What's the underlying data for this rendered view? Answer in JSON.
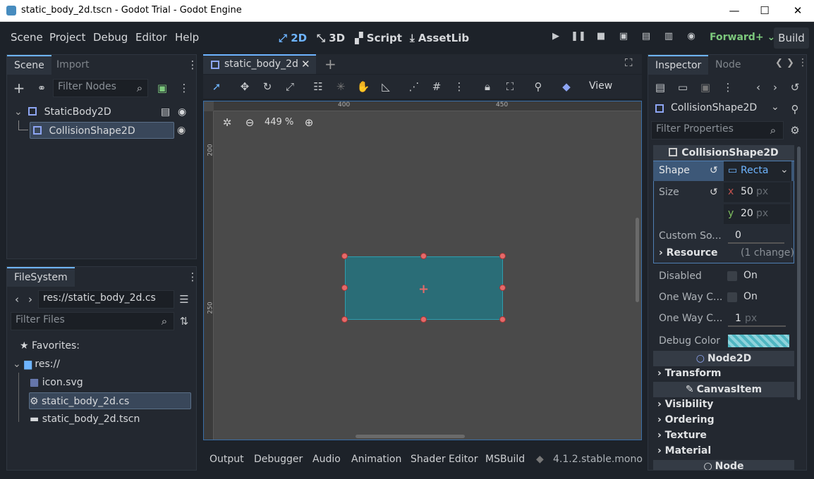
{
  "window": {
    "title": "static_body_2d.tscn - Godot Trial - Godot Engine",
    "minimize": "—",
    "maximize": "☐",
    "close": "✕"
  },
  "menu": [
    "Scene",
    "Project",
    "Debug",
    "Editor",
    "Help"
  ],
  "workspaces": [
    {
      "label": "2D",
      "icon": "2d-icon",
      "active": true
    },
    {
      "label": "3D",
      "icon": "3d-icon",
      "active": false
    },
    {
      "label": "Script",
      "icon": "script-icon",
      "active": false
    },
    {
      "label": "AssetLib",
      "icon": "assetlib-icon",
      "active": false
    }
  ],
  "renderer": "Forward+",
  "build_label": "Build",
  "scene_dock": {
    "tabs": [
      "Scene",
      "Import"
    ],
    "filter_placeholder": "Filter Nodes",
    "nodes": [
      {
        "name": "StaticBody2D"
      },
      {
        "name": "CollisionShape2D"
      }
    ]
  },
  "filesystem_dock": {
    "tab": "FileSystem",
    "path": "res://static_body_2d.cs",
    "filter_placeholder": "Filter Files",
    "items": [
      {
        "label": "Favorites:"
      },
      {
        "label": "res://"
      },
      {
        "label": "icon.svg"
      },
      {
        "label": "static_body_2d.cs"
      },
      {
        "label": "static_body_2d.tscn"
      }
    ]
  },
  "editor": {
    "scene_tab": "static_body_2d",
    "zoom": "449 %",
    "view_menu": "View",
    "ruler_labels": {
      "h1": "400",
      "h2": "450",
      "v1": "200",
      "v2": "250"
    }
  },
  "bottom_tabs": [
    "Output",
    "Debugger",
    "Audio",
    "Animation",
    "Shader Editor",
    "MSBuild"
  ],
  "version": "4.1.2.stable.mono",
  "inspector": {
    "tabs": [
      "Inspector",
      "Node"
    ],
    "selected_node": "CollisionShape2D",
    "filter_placeholder": "Filter Properties",
    "class_header": "CollisionShape2D",
    "shape_label": "Shape",
    "shape_value": "Recta",
    "size_label": "Size",
    "size_x": "50",
    "size_y": "20",
    "unit": "px",
    "x_label": "x",
    "y_label": "y",
    "custom_solver_label": "Custom So...",
    "custom_solver_value": "0",
    "resource_label": "Resource",
    "resource_changes": "(1 change)",
    "disabled_label": "Disabled",
    "disabled_value": "On",
    "one_way_label": "One Way C...",
    "one_way_value": "On",
    "one_way_margin_label": "One Way C...",
    "one_way_margin_value": "1",
    "debug_color_label": "Debug Color",
    "node2d_header": "Node2D",
    "transform_label": "Transform",
    "canvasitem_header": "CanvasItem",
    "visibility_label": "Visibility",
    "ordering_label": "Ordering",
    "texture_label": "Texture",
    "material_label": "Material",
    "node_header": "Node"
  },
  "colors": {
    "accent": "#6eb4ff",
    "shape_fill": "#2a6d77",
    "handle": "#e46a6a",
    "renderer": "#7cc87c"
  }
}
